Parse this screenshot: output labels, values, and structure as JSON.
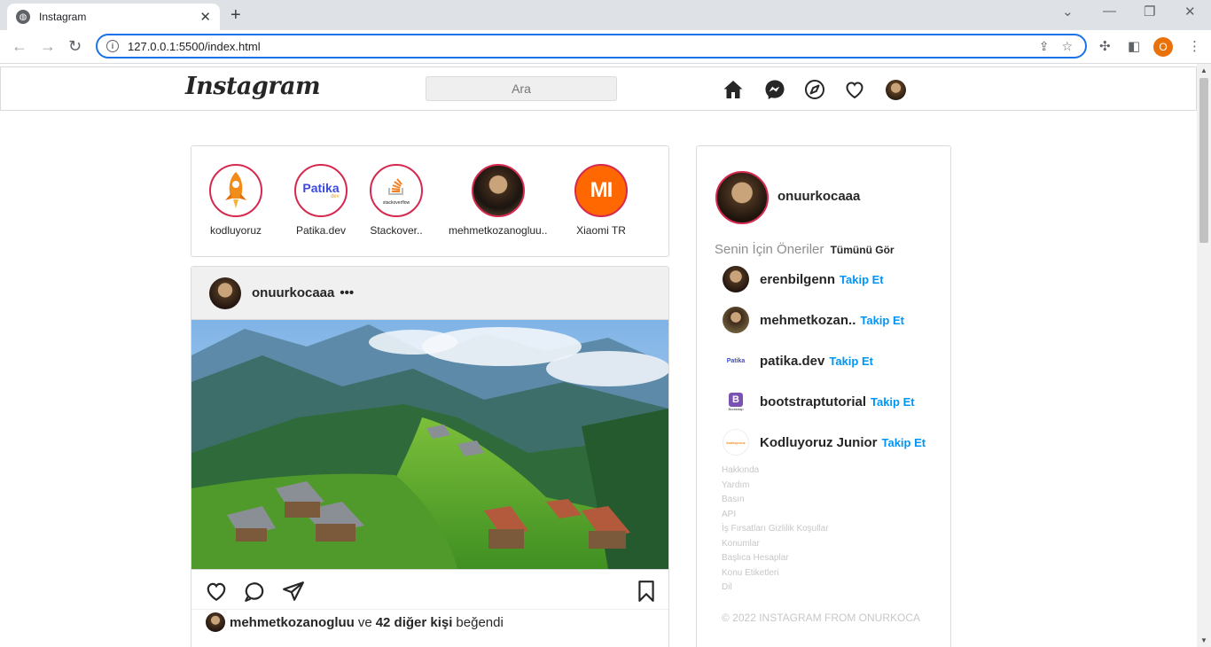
{
  "browser": {
    "tab_title": "Instagram",
    "url": "127.0.0.1:5500/index.html",
    "profile_initial": "O"
  },
  "header": {
    "logo": "Instagram",
    "search_placeholder": "Ara",
    "nav_icons": [
      "home-icon",
      "messenger-icon",
      "explore-icon",
      "heart-icon",
      "profile-avatar"
    ]
  },
  "stories": [
    {
      "name": "kodluyoruz",
      "icon": "rocket-icon"
    },
    {
      "name": "Patika.dev",
      "icon": "patika-logo",
      "logo_text": "Patika",
      "logo_sub": "dev"
    },
    {
      "name": "Stackover..",
      "icon": "stackoverflow-logo",
      "logo_text": "stackoverflow"
    },
    {
      "name": "mehmetkozanogluu..",
      "icon": "photo-avatar"
    },
    {
      "name": "Xiaomi TR",
      "icon": "mi-logo",
      "logo_text": "MI"
    }
  ],
  "post": {
    "username": "onuurkocaaa",
    "more": "•••",
    "liked_by": "mehmetkozanogluu",
    "liked_conj": "ve",
    "liked_others": "42 diğer kişi",
    "liked_suffix": "beğendi"
  },
  "sidebar": {
    "username": "onuurkocaaa",
    "suggestions_title": "Senin İçin Öneriler",
    "see_all": "Tümünü Gör",
    "follow_label": "Takip Et",
    "suggestions": [
      {
        "name": "erenbilgenn",
        "avatar": "photo"
      },
      {
        "name": "mehmetkozan..",
        "avatar": "photo"
      },
      {
        "name": "patika.dev",
        "avatar": "patika",
        "logo_text": "Patika"
      },
      {
        "name": "bootstraptutorial",
        "avatar": "bootstrap",
        "logo_text": "B",
        "logo_sub": "Bootstrap"
      },
      {
        "name": "Kodluyoruz Junior",
        "avatar": "kodluyoruz",
        "logo_text": "kodluyoruz"
      }
    ],
    "footer_links": [
      "Hakkında",
      "Yardım",
      "Basın",
      "API",
      "İş Fırsatları Gizlilik Koşullar",
      "Konumlar",
      "Başlıca Hesaplar",
      "Konu Etiketleri",
      "Dil"
    ],
    "copyright": "© 2022 INSTAGRAM FROM ONURKOCA"
  },
  "colors": {
    "story_ring": "#d6294f",
    "follow_blue": "#0095f6",
    "browser_accent": "#1a73e8"
  }
}
